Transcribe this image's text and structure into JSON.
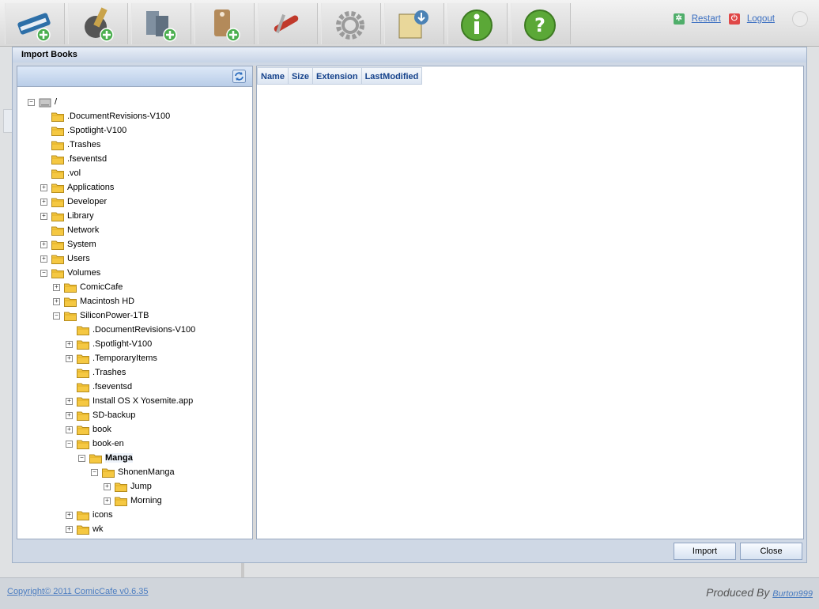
{
  "toolbar": {
    "buttons": [
      {
        "name": "add-book-icon",
        "color": "#2d6fa8"
      },
      {
        "name": "add-author-icon",
        "color": "#4a4a4a"
      },
      {
        "name": "add-server-icon",
        "color": "#607080"
      },
      {
        "name": "add-tag-icon",
        "color": "#b38a5a"
      },
      {
        "name": "tools-icon",
        "color": "#c0392b"
      },
      {
        "name": "settings-gear-icon",
        "color": "#9a9a9a"
      },
      {
        "name": "import-disk-icon",
        "color": "#4b82b5"
      },
      {
        "name": "info-icon",
        "color": "#5ba837"
      },
      {
        "name": "help-icon",
        "color": "#5ba837"
      }
    ],
    "restart_label": "Restart",
    "logout_label": "Logout"
  },
  "dialog": {
    "title": "Import Books",
    "columns": [
      "Name",
      "Size",
      "Extension",
      "LastModified"
    ],
    "import_label": "Import",
    "close_label": "Close",
    "tree": [
      {
        "label": "/",
        "depth": 0,
        "state": "open",
        "icon": "drive"
      },
      {
        "label": ".DocumentRevisions-V100",
        "depth": 1,
        "state": "leaf"
      },
      {
        "label": ".Spotlight-V100",
        "depth": 1,
        "state": "leaf"
      },
      {
        "label": ".Trashes",
        "depth": 1,
        "state": "leaf"
      },
      {
        "label": ".fseventsd",
        "depth": 1,
        "state": "leaf"
      },
      {
        "label": ".vol",
        "depth": 1,
        "state": "leaf"
      },
      {
        "label": "Applications",
        "depth": 1,
        "state": "closed"
      },
      {
        "label": "Developer",
        "depth": 1,
        "state": "closed"
      },
      {
        "label": "Library",
        "depth": 1,
        "state": "closed"
      },
      {
        "label": "Network",
        "depth": 1,
        "state": "leaf"
      },
      {
        "label": "System",
        "depth": 1,
        "state": "closed"
      },
      {
        "label": "Users",
        "depth": 1,
        "state": "closed"
      },
      {
        "label": "Volumes",
        "depth": 1,
        "state": "open"
      },
      {
        "label": "ComicCafe",
        "depth": 2,
        "state": "closed"
      },
      {
        "label": "Macintosh HD",
        "depth": 2,
        "state": "closed"
      },
      {
        "label": "SiliconPower-1TB",
        "depth": 2,
        "state": "open"
      },
      {
        "label": ".DocumentRevisions-V100",
        "depth": 3,
        "state": "leaf"
      },
      {
        "label": ".Spotlight-V100",
        "depth": 3,
        "state": "closed"
      },
      {
        "label": ".TemporaryItems",
        "depth": 3,
        "state": "closed"
      },
      {
        "label": ".Trashes",
        "depth": 3,
        "state": "leaf"
      },
      {
        "label": ".fseventsd",
        "depth": 3,
        "state": "leaf"
      },
      {
        "label": "Install OS X Yosemite.app",
        "depth": 3,
        "state": "closed"
      },
      {
        "label": "SD-backup",
        "depth": 3,
        "state": "closed"
      },
      {
        "label": "book",
        "depth": 3,
        "state": "closed"
      },
      {
        "label": "book-en",
        "depth": 3,
        "state": "open"
      },
      {
        "label": "Manga",
        "depth": 4,
        "state": "open",
        "selected": true
      },
      {
        "label": "ShonenManga",
        "depth": 5,
        "state": "open"
      },
      {
        "label": "Jump",
        "depth": 6,
        "state": "closed"
      },
      {
        "label": "Morning",
        "depth": 6,
        "state": "closed"
      },
      {
        "label": "icons",
        "depth": 3,
        "state": "closed"
      },
      {
        "label": "wk",
        "depth": 3,
        "state": "closed"
      }
    ]
  },
  "footer": {
    "copyright": "Copyright© 2011 ComicCafe v0.6.35",
    "produced_by": "Produced By",
    "author": "Burton999"
  }
}
